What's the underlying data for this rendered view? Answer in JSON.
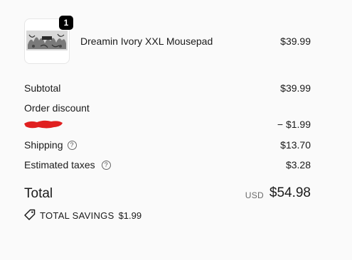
{
  "line_item": {
    "quantity": "1",
    "name": "Dreamin Ivory XXL Mousepad",
    "price": "$39.99"
  },
  "summary": {
    "subtotal_label": "Subtotal",
    "subtotal_value": "$39.99",
    "discount_label": "Order discount",
    "discount_value": "− $1.99",
    "shipping_label": "Shipping",
    "shipping_value": "$13.70",
    "taxes_label": "Estimated taxes",
    "taxes_value": "$3.28"
  },
  "total": {
    "label": "Total",
    "currency": "USD",
    "amount": "$54.98"
  },
  "savings": {
    "label": "TOTAL SAVINGS",
    "amount": "$1.99"
  },
  "icons": {
    "shipping_help": "question-circle-icon",
    "taxes_help": "question-circle-icon",
    "savings": "price-tag-icon"
  },
  "colors": {
    "background": "#fafafa",
    "text": "#1a1a1a",
    "redaction": "#e02020"
  }
}
